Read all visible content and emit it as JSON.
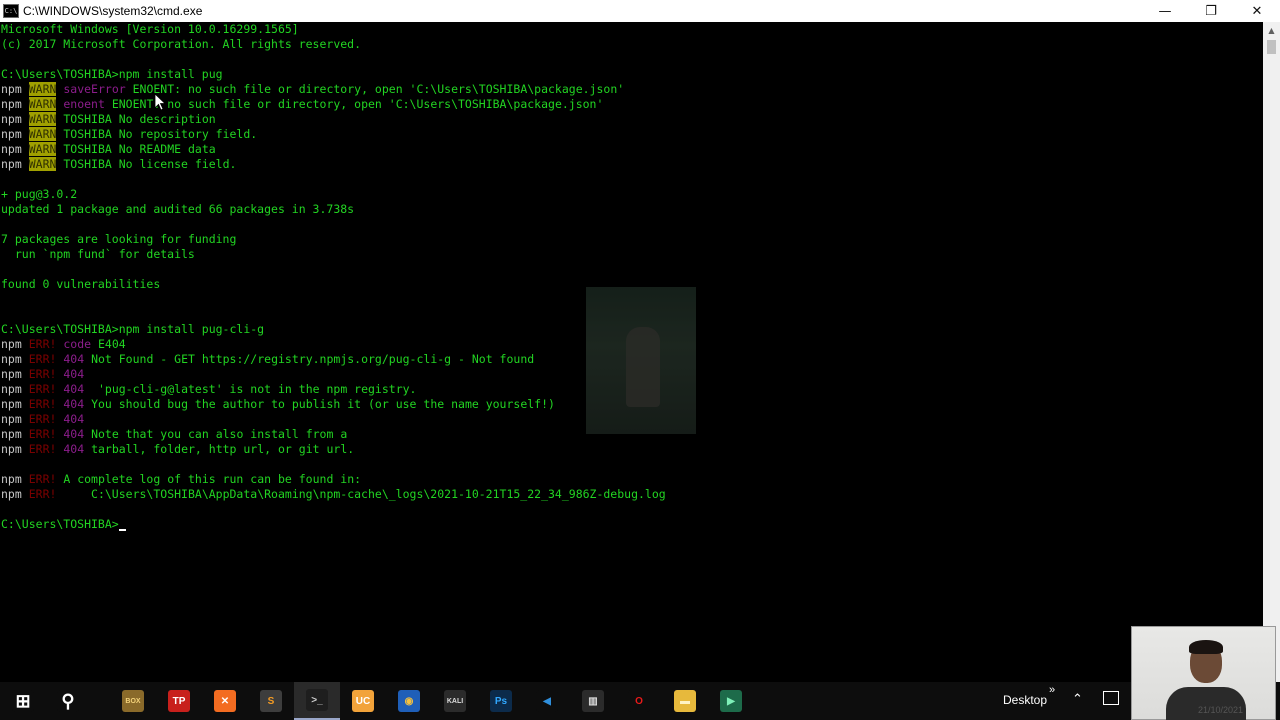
{
  "window": {
    "title": "C:\\WINDOWS\\system32\\cmd.exe",
    "icon_text": "C:\\",
    "controls": {
      "minimize": "—",
      "maximize": "❐",
      "close": "✕"
    }
  },
  "terminal": {
    "lines": [
      {
        "type": "plain",
        "text": "Microsoft Windows [Version 10.0.16299.1565]"
      },
      {
        "type": "plain",
        "text": "(c) 2017 Microsoft Corporation. All rights reserved."
      },
      {
        "type": "blank",
        "text": ""
      },
      {
        "type": "plain",
        "text": "C:\\Users\\TOSHIBA>npm install pug"
      },
      {
        "type": "warn",
        "prefix": "npm",
        "tag": "WARN",
        "sub": "saveError",
        "text": " ENOENT: no such file or directory, open 'C:\\Users\\TOSHIBA\\package.json'"
      },
      {
        "type": "warn",
        "prefix": "npm",
        "tag": "WARN",
        "sub": "enoent",
        "text": " ENOENT: no such file or directory, open 'C:\\Users\\TOSHIBA\\package.json'"
      },
      {
        "type": "warn",
        "prefix": "npm",
        "tag": "WARN",
        "sub": "",
        "text": " TOSHIBA No description"
      },
      {
        "type": "warn",
        "prefix": "npm",
        "tag": "WARN",
        "sub": "",
        "text": " TOSHIBA No repository field."
      },
      {
        "type": "warn",
        "prefix": "npm",
        "tag": "WARN",
        "sub": "",
        "text": " TOSHIBA No README data"
      },
      {
        "type": "warn",
        "prefix": "npm",
        "tag": "WARN",
        "sub": "",
        "text": " TOSHIBA No license field."
      },
      {
        "type": "blank",
        "text": ""
      },
      {
        "type": "plain",
        "text": "+ pug@3.0.2"
      },
      {
        "type": "plain",
        "text": "updated 1 package and audited 66 packages in 3.738s"
      },
      {
        "type": "blank",
        "text": ""
      },
      {
        "type": "plain",
        "text": "7 packages are looking for funding"
      },
      {
        "type": "plain",
        "text": "  run `npm fund` for details"
      },
      {
        "type": "blank",
        "text": ""
      },
      {
        "type": "plain",
        "text": "found 0 vulnerabilities"
      },
      {
        "type": "blank",
        "text": ""
      },
      {
        "type": "blank",
        "text": ""
      },
      {
        "type": "plain",
        "text": "C:\\Users\\TOSHIBA>npm install pug-cli-g"
      },
      {
        "type": "err",
        "prefix": "npm",
        "tag": "ERR!",
        "sub": "code",
        "text": " E404"
      },
      {
        "type": "err",
        "prefix": "npm",
        "tag": "ERR!",
        "sub": "404",
        "text": " Not Found - GET https://registry.npmjs.org/pug-cli-g - Not found"
      },
      {
        "type": "err",
        "prefix": "npm",
        "tag": "ERR!",
        "sub": "404",
        "text": ""
      },
      {
        "type": "err",
        "prefix": "npm",
        "tag": "ERR!",
        "sub": "404",
        "text": "  'pug-cli-g@latest' is not in the npm registry."
      },
      {
        "type": "err",
        "prefix": "npm",
        "tag": "ERR!",
        "sub": "404",
        "text": " You should bug the author to publish it (or use the name yourself!)"
      },
      {
        "type": "err",
        "prefix": "npm",
        "tag": "ERR!",
        "sub": "404",
        "text": ""
      },
      {
        "type": "err",
        "prefix": "npm",
        "tag": "ERR!",
        "sub": "404",
        "text": " Note that you can also install from a"
      },
      {
        "type": "err",
        "prefix": "npm",
        "tag": "ERR!",
        "sub": "404",
        "text": " tarball, folder, http url, or git url."
      },
      {
        "type": "blank",
        "text": ""
      },
      {
        "type": "err",
        "prefix": "npm",
        "tag": "ERR!",
        "sub": "",
        "text": " A complete log of this run can be found in:"
      },
      {
        "type": "err",
        "prefix": "npm",
        "tag": "ERR!",
        "sub": "",
        "text": "     C:\\Users\\TOSHIBA\\AppData\\Roaming\\npm-cache\\_logs\\2021-10-21T15_22_34_986Z-debug.log"
      },
      {
        "type": "blank",
        "text": ""
      },
      {
        "type": "prompt",
        "text": "C:\\Users\\TOSHIBA>"
      }
    ]
  },
  "taskbar": {
    "items": [
      {
        "name": "start-button",
        "label": "⊞",
        "color": "#0d0d0d",
        "fg": "#ffffff"
      },
      {
        "name": "search-icon",
        "label": "⚲",
        "color": "#0d0d0d",
        "fg": "#ffffff"
      },
      {
        "name": "dosbox-icon",
        "label": "BOX",
        "color": "#8a6a2a",
        "fg": "#f3d27a"
      },
      {
        "name": "tp-icon",
        "label": "TP",
        "color": "#c8201c",
        "fg": "#ffffff"
      },
      {
        "name": "xampp-icon",
        "label": "✕",
        "color": "#f36c21",
        "fg": "#ffffff"
      },
      {
        "name": "sublime-icon",
        "label": "S",
        "color": "#3d3d3d",
        "fg": "#f59c24"
      },
      {
        "name": "cmd-icon",
        "label": ">_",
        "color": "#1e1e1e",
        "fg": "#cfcfcf"
      },
      {
        "name": "uc-browser-icon",
        "label": "UC",
        "color": "#f2a33a",
        "fg": "#ffffff"
      },
      {
        "name": "globe-icon",
        "label": "◉",
        "color": "#1f5fb8",
        "fg": "#f6c23d"
      },
      {
        "name": "kali-icon",
        "label": "KALI",
        "color": "#2b2b2b",
        "fg": "#dcdcdc"
      },
      {
        "name": "photoshop-icon",
        "label": "Ps",
        "color": "#0c2b4b",
        "fg": "#31a8ff"
      },
      {
        "name": "vscode-icon",
        "label": "◀",
        "color": "#0d0d0d",
        "fg": "#2f8fdc"
      },
      {
        "name": "piano-icon",
        "label": "▥",
        "color": "#2b2b2b",
        "fg": "#dcdcdc"
      },
      {
        "name": "opera-icon",
        "label": "O",
        "color": "#0d0d0d",
        "fg": "#e81a1a"
      },
      {
        "name": "file-explorer-icon",
        "label": "▬",
        "color": "#e7b93c",
        "fg": "#fff3c4"
      },
      {
        "name": "app-icon",
        "label": "▶",
        "color": "#1d6b4a",
        "fg": "#7ef0b8"
      }
    ],
    "desktop_label": "Desktop",
    "chevron": "»",
    "tray_up": "⌃"
  },
  "webcam": {
    "clock": "21/10/2021"
  }
}
